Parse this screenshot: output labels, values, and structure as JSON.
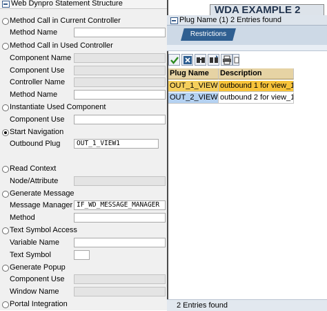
{
  "left_panel": {
    "title": "Web Dynpro Statement Structure",
    "close_glyph": "⊠",
    "options": [
      {
        "label": "Method Call in Current Controller",
        "selected": false,
        "fields": [
          {
            "label": "Method Name",
            "value": "",
            "disabled": false
          }
        ]
      },
      {
        "label": "Method Call in Used Controller",
        "selected": false,
        "fields": [
          {
            "label": "Component Name",
            "value": "",
            "disabled": true
          },
          {
            "label": "Component Use",
            "value": "",
            "disabled": true
          },
          {
            "label": "Controller Name",
            "value": "",
            "disabled": true
          },
          {
            "label": "Method Name",
            "value": "",
            "disabled": false
          }
        ]
      },
      {
        "label": "Instantiate Used Component",
        "selected": false,
        "fields": [
          {
            "label": "Component Use",
            "value": "",
            "disabled": false
          }
        ]
      },
      {
        "label": "Start Navigation",
        "selected": true,
        "fields": [
          {
            "label": "Outbound Plug",
            "value": "OUT_1_VIEW1",
            "disabled": false
          }
        ]
      },
      {
        "label": "Read Context",
        "selected": false,
        "fields": [
          {
            "label": "Node/Attribute",
            "value": "",
            "disabled": true
          }
        ]
      },
      {
        "label": "Generate Message",
        "selected": false,
        "fields": [
          {
            "label": "Message Manager",
            "value": "IF_WD_MESSAGE_MANAGER",
            "disabled": false
          },
          {
            "label": "Method",
            "value": "",
            "disabled": false
          }
        ]
      },
      {
        "label": "Text Symbol Access",
        "selected": false,
        "fields": [
          {
            "label": "Variable Name",
            "value": "",
            "disabled": false
          },
          {
            "label": "Text Symbol",
            "value": "",
            "disabled": false
          }
        ]
      },
      {
        "label": "Generate Popup",
        "selected": false,
        "fields": [
          {
            "label": "Component Use",
            "value": "",
            "disabled": true
          },
          {
            "label": "Window Name",
            "value": "",
            "disabled": true
          }
        ]
      },
      {
        "label": "Portal Integration",
        "selected": false,
        "fields": []
      }
    ]
  },
  "right_panel": {
    "header": "WDA  EXAMPLE  2",
    "popup_title": "Plug Name (1)   2 Entries found",
    "tab_restrictions": "Restrictions",
    "toolbar": [
      "check-icon",
      "cancel-icon",
      "find-icon",
      "find-next-icon",
      "print-icon"
    ],
    "table": {
      "columns": [
        "Plug Name",
        "Description"
      ],
      "rows": [
        [
          "OUT_1_VIEW1",
          "outbound 1 for view_1"
        ],
        [
          "OUT_2_VIEW1",
          "outbound 2 for view_1"
        ]
      ]
    },
    "status": "2 Entries found"
  },
  "colors": {
    "selected_row": "#f7c33a",
    "highlight_cell": "#b5d2f2",
    "header_bg": "#e6d3a4",
    "tab_active": "#2f5f91"
  }
}
